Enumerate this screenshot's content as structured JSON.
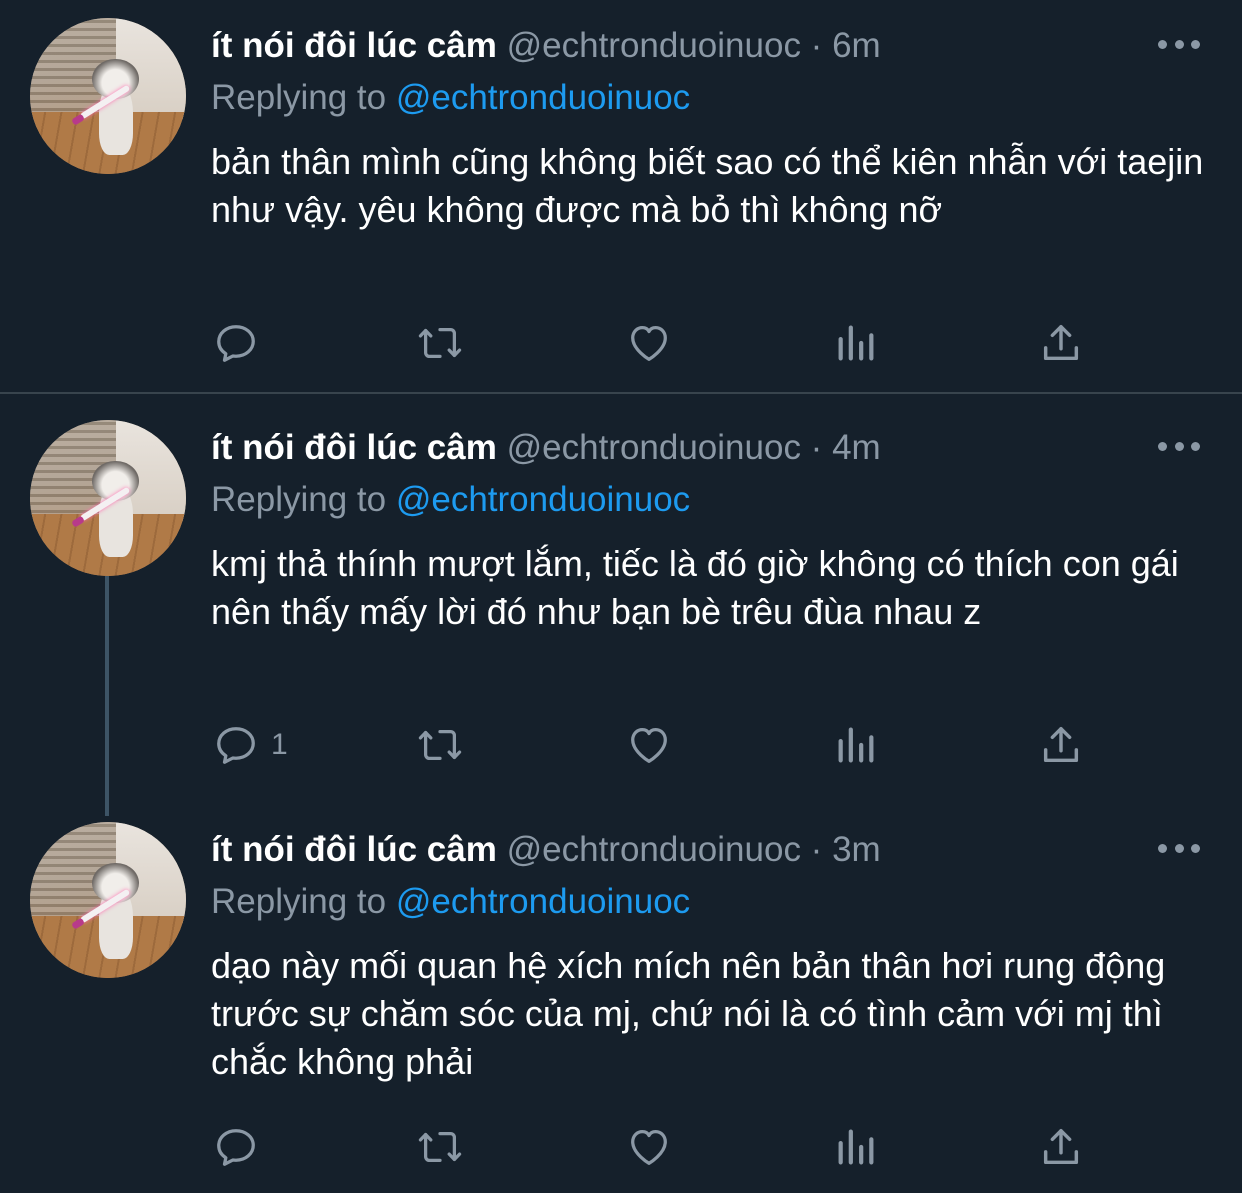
{
  "colors": {
    "background": "#15202b",
    "text": "#ffffff",
    "muted": "#8b98a5",
    "accent": "#1d9bf0",
    "divider": "#38444d"
  },
  "tweets": [
    {
      "name": "ít nói đôi lúc câm",
      "handle": "@echtronduoinuoc",
      "dot": " · ",
      "time": "6m",
      "replying_prefix": "Replying to ",
      "replying_to": "@echtronduoinuoc",
      "text": "bản thân mình cũng không biết sao có thể kiên nhẫn với taejin như vậy. yêu không được mà bỏ thì không nỡ",
      "reply_count": "",
      "icons": [
        "reply-icon",
        "retweet-icon",
        "like-icon",
        "analytics-icon",
        "share-icon"
      ]
    },
    {
      "name": "ít nói đôi lúc câm",
      "handle": "@echtronduoinuoc",
      "dot": " · ",
      "time": "4m",
      "replying_prefix": "Replying to ",
      "replying_to": "@echtronduoinuoc",
      "text": "kmj thả thính mượt lắm, tiếc là đó giờ không có thích con gái nên thấy mấy lời đó như bạn bè trêu đùa nhau z",
      "reply_count": "1",
      "icons": [
        "reply-icon",
        "retweet-icon",
        "like-icon",
        "analytics-icon",
        "share-icon"
      ]
    },
    {
      "name": "ít nói đôi lúc câm",
      "handle": "@echtronduoinuoc",
      "dot": " · ",
      "time": "3m",
      "replying_prefix": "Replying to ",
      "replying_to": "@echtronduoinuoc",
      "text": "dạo này mối quan hệ xích mích nên bản thân hơi rung động trước sự chăm sóc của mj, chứ nói là có tình cảm với mj thì chắc không phải",
      "reply_count": "",
      "icons": [
        "reply-icon",
        "retweet-icon",
        "like-icon",
        "analytics-icon",
        "share-icon"
      ]
    }
  ]
}
